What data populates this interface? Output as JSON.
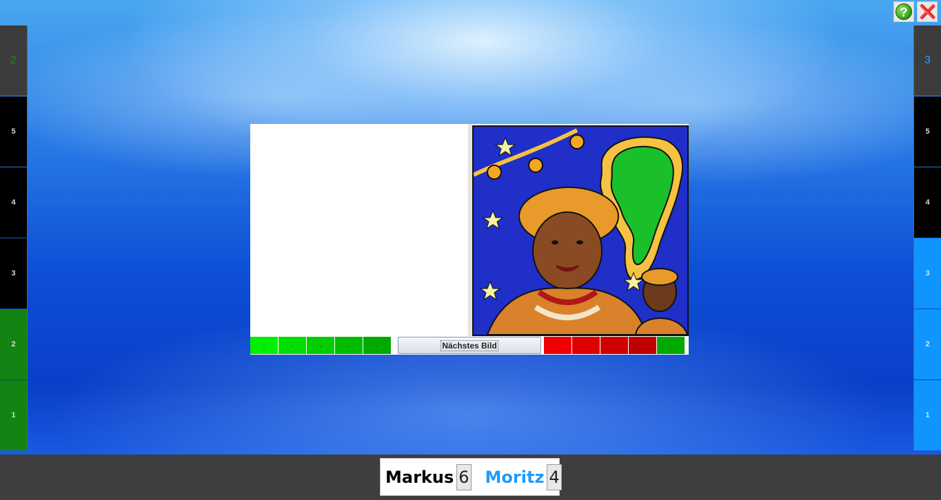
{
  "top_buttons": {
    "help": "?",
    "close": "close"
  },
  "left_column": {
    "score": "2",
    "cells": [
      "5",
      "4",
      "3",
      "2",
      "1"
    ]
  },
  "right_column": {
    "score": "3",
    "cells": [
      "5",
      "4",
      "3",
      "2",
      "1"
    ]
  },
  "board": {
    "next_button": "Nächstes Bild",
    "left_segments": [
      ".",
      ".",
      ".",
      ".",
      "."
    ],
    "right_segments": [
      ".",
      ".",
      ".",
      ".",
      "."
    ]
  },
  "players": [
    {
      "name": "Markus",
      "score": "6",
      "color": "#000000"
    },
    {
      "name": "Moritz",
      "score": "4",
      "color": "#1e9bff"
    }
  ],
  "icons": {
    "help": "help-icon",
    "close": "close-icon"
  }
}
